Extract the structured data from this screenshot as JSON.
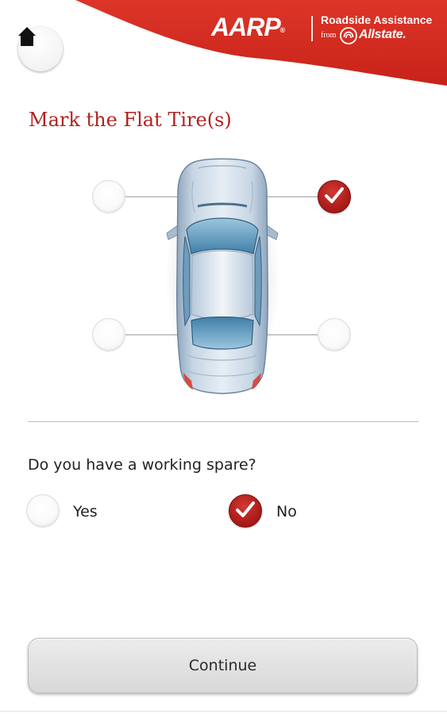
{
  "header": {
    "brand_name": "AARP",
    "brand_mark": "®",
    "service_name": "Roadside Assistance",
    "from_text": "from",
    "partner_name": "Allstate",
    "partner_mark": ".",
    "brand_color": "#d52b1e",
    "home_icon": "home-icon"
  },
  "page": {
    "title": "Mark the Flat Tire(s)",
    "title_color": "#b3211e"
  },
  "tires": [
    {
      "position": "front-left",
      "selected": false
    },
    {
      "position": "front-right",
      "selected": true
    },
    {
      "position": "rear-left",
      "selected": false
    },
    {
      "position": "rear-right",
      "selected": false
    }
  ],
  "spare": {
    "question": "Do you have a working spare?",
    "options": [
      {
        "label": "Yes",
        "selected": false
      },
      {
        "label": "No",
        "selected": true
      }
    ]
  },
  "actions": {
    "continue_label": "Continue"
  },
  "colors": {
    "accent": "#b01f1b",
    "car_body": "#b7c9da",
    "car_glass": "#5f96b9"
  }
}
